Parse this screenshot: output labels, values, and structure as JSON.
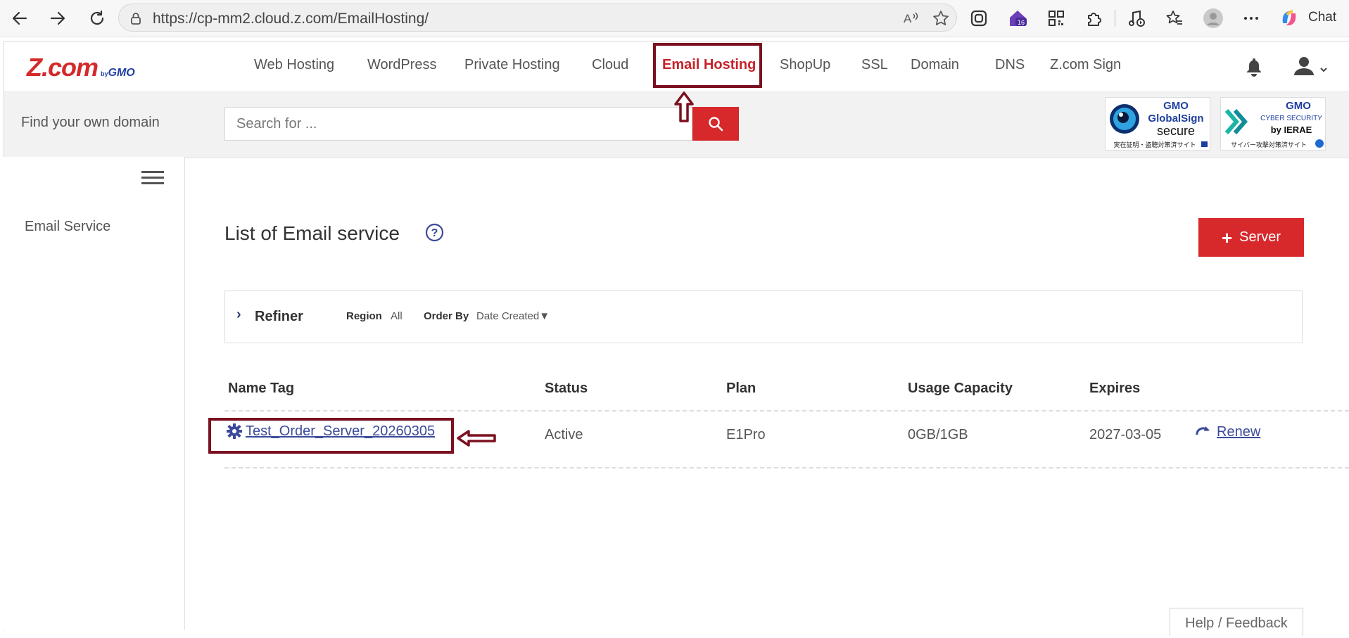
{
  "browser": {
    "url": "https://cp-mm2.cloud.z.com/EmailHosting/",
    "extension_badge": "16",
    "chat_label": "Chat",
    "icons": [
      "back-icon",
      "forward-icon",
      "refresh-icon",
      "lock-icon",
      "read-aloud-icon",
      "favorite-star-icon",
      "extension-icon",
      "qr-icon",
      "puzzle-icon",
      "media-icon",
      "favorites-icon",
      "profile-icon",
      "more-icon",
      "copilot-icon"
    ]
  },
  "header": {
    "logo_main": "Z.com",
    "logo_by": "by",
    "logo_gmo": "GMO",
    "nav": [
      {
        "label": "Web Hosting"
      },
      {
        "label": "WordPress"
      },
      {
        "label": "Private Hosting"
      },
      {
        "label": "Cloud"
      },
      {
        "label": "Email Hosting",
        "active": true
      },
      {
        "label": "ShopUp"
      },
      {
        "label": "SSL"
      },
      {
        "label": "Domain"
      },
      {
        "label": "DNS"
      },
      {
        "label": "Z.com Sign"
      }
    ]
  },
  "search": {
    "label": "Find your own domain",
    "placeholder": "Search for ..."
  },
  "badges": {
    "globalsign": {
      "brand": "GMO",
      "line1": "GlobalSign",
      "line2": "secure",
      "caption": "実在証明・盗聴対策済サイト"
    },
    "cybersecurity": {
      "brand": "GMO",
      "line1": "CYBER SECURITY",
      "line2": "by IERAE",
      "caption": "サイバー攻撃対策済サイト"
    }
  },
  "sidebar": {
    "items": [
      {
        "label": "Email Service"
      }
    ]
  },
  "main": {
    "title": "List of Email service",
    "add_button": "Server",
    "refiner": {
      "title": "Refiner",
      "region_label": "Region",
      "region_value": "All",
      "order_label": "Order By",
      "order_value": "Date Created▼"
    },
    "table": {
      "headers": [
        "Name Tag",
        "Status",
        "Plan",
        "Usage Capacity",
        "Expires"
      ],
      "rows": [
        {
          "name": "Test_Order_Server_20260305",
          "status": "Active",
          "plan": "E1Pro",
          "usage": "0GB/1GB",
          "expires": "2027-03-05",
          "action": "Renew"
        }
      ]
    },
    "help_feedback": "Help / Feedback"
  },
  "colors": {
    "brand_red": "#d7282b",
    "annotation": "#7b1020",
    "link": "#3b4a9a"
  }
}
